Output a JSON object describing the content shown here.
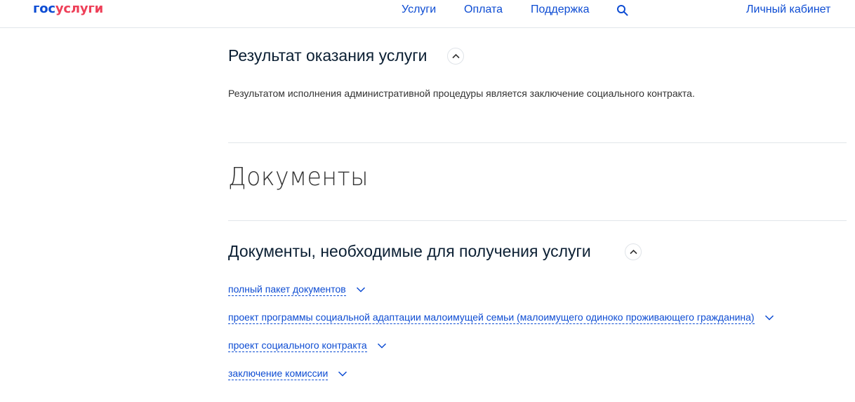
{
  "header": {
    "logo_gos": "гос",
    "logo_uslugi": "услуги",
    "nav": [
      "Услуги",
      "Оплата",
      "Поддержка"
    ],
    "account": "Личный кабинет"
  },
  "result": {
    "title": "Результат оказания услуги",
    "text": "Результатом исполнения административной процедуры является заключение социального контракта."
  },
  "documents": {
    "heading": "Документы",
    "required_title": "Документы, необходимые для получения услуги",
    "items": [
      "полный пакет документов",
      "проект программы социальной адаптации малоимущей семьи (малоимущего одиноко проживающего гражданина)",
      "проект социального контракта",
      "заключение комиссии"
    ]
  }
}
